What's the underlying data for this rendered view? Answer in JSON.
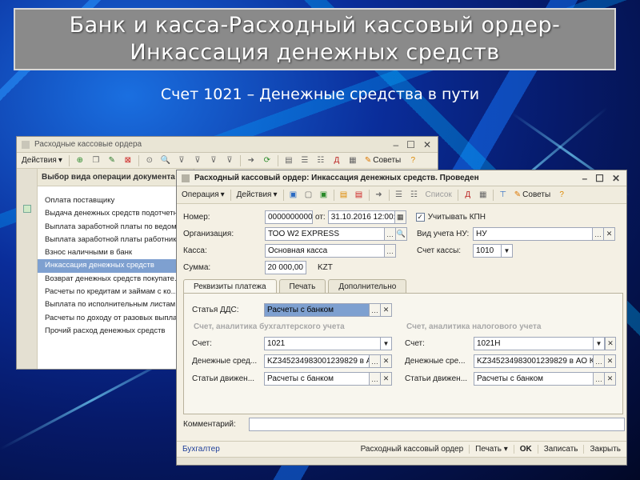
{
  "slide": {
    "title_line1": "Банк и касса-Расходный кассовый ордер-",
    "title_line2": "Инкассация денежных средств",
    "subtitle": "Счет 1021 – Денежные средства в пути"
  },
  "back_window": {
    "title": "Расходные кассовые ордера",
    "toolbar_actions_label": "Действия",
    "toolbar_advice_label": "Советы",
    "list_title": "Выбор вида операции документа",
    "items": [
      "Оплата поставщику",
      "Выдача денежных средств подотчетному...",
      "Выплата заработной платы по ведомо...",
      "Выплата заработной платы работнику",
      "Взнос наличными в банк",
      "Инкассация денежных средств",
      "Возврат денежных средств покупате...",
      "Расчеты по кредитам и займам с ко...",
      "Выплата по исполнительным листам",
      "Расчеты по доходу от разовых выпла...",
      "Прочий расход денежных средств"
    ],
    "selected_index": 5
  },
  "front_window": {
    "title": "Расходный кассовый ордер: Инкассация денежных средств. Проведен",
    "menu": {
      "operation": "Операция",
      "actions": "Действия",
      "list": "Список",
      "advice": "Советы"
    },
    "fields": {
      "number_label": "Номер:",
      "number_value": "0000000000",
      "from_label": "от:",
      "date_value": "31.10.2016 12:00:",
      "kpn_label": "Учитывать КПН",
      "kpn_checked": true,
      "org_label": "Организация:",
      "org_value": "ТОО W2 EXPRESS",
      "nu_label": "Вид учета НУ:",
      "nu_value": "НУ",
      "cash_label": "Касса:",
      "cash_value": "Основная касса",
      "cash_acc_label": "Счет кассы:",
      "cash_acc_value": "1010",
      "sum_label": "Сумма:",
      "sum_value": "20 000,00",
      "currency": "KZT"
    },
    "tabs": [
      "Реквизиты платежа",
      "Печать",
      "Дополнительно"
    ],
    "active_tab": 0,
    "payment": {
      "dds_label": "Статья ДДС:",
      "dds_value": "Расчеты с банком",
      "accounting_title": "Счет, аналитика бухгалтерского учета",
      "tax_title": "Счет, аналитика налогового учета",
      "account_label": "Счет:",
      "account_value": "1021",
      "tax_account_value": "1021Н",
      "money_label": "Денежные сред...",
      "money_value": "KZ345234983001239829 в А",
      "money_label_tax": "Денежные сре...",
      "money_value_tax": "KZ345234983001239829 в АО К",
      "movement_label": "Статьи движен...",
      "movement_label_tax": "Статьи движен...",
      "movement_value": "Расчеты с банком",
      "movement_value_tax": "Расчеты с банком"
    },
    "comment_label": "Комментарий:",
    "comment_value": "",
    "status": {
      "user": "Бухгалтер",
      "doc": "Расходный кассовый ордер",
      "print": "Печать",
      "ok": "OK",
      "save": "Записать",
      "close": "Закрыть"
    }
  }
}
